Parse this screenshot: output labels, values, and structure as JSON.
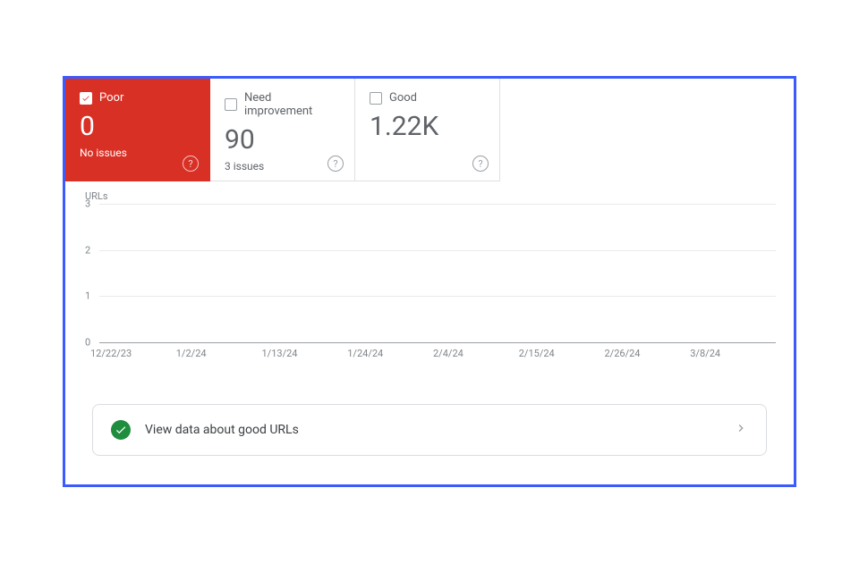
{
  "tabs": [
    {
      "label": "Poor",
      "value": "0",
      "issues": "No issues",
      "active": true
    },
    {
      "label": "Need improvement",
      "value": "90",
      "issues": "3 issues",
      "active": false
    },
    {
      "label": "Good",
      "value": "1.22K",
      "issues": "",
      "active": false
    }
  ],
  "help_glyph": "?",
  "chart": {
    "ylabel": "URLs",
    "yticks": [
      "3",
      "2",
      "1",
      "0"
    ],
    "xticks": [
      "12/22/23",
      "1/2/24",
      "1/13/24",
      "1/24/24",
      "2/4/24",
      "2/15/24",
      "2/26/24",
      "3/8/24"
    ]
  },
  "bottom_link": {
    "label": "View data about good URLs"
  },
  "chart_data": {
    "type": "line",
    "title": "",
    "xlabel": "",
    "ylabel": "URLs",
    "ylim": [
      0,
      3
    ],
    "categories": [
      "12/22/23",
      "1/2/24",
      "1/13/24",
      "1/24/24",
      "2/4/24",
      "2/15/24",
      "2/26/24",
      "3/8/24"
    ],
    "series": [
      {
        "name": "Poor",
        "values": [
          0,
          0,
          0,
          0,
          0,
          0,
          0,
          0
        ]
      }
    ]
  }
}
